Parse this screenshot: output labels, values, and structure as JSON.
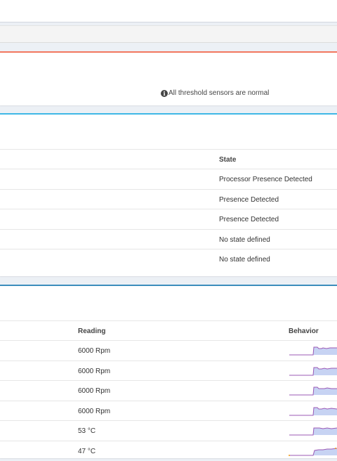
{
  "threshold_panel": {
    "status_text": "All threshold sensors are normal",
    "icon": "info-circle-icon"
  },
  "state_table": {
    "header": "State",
    "rows": [
      "Processor Presence Detected",
      "Presence Detected",
      "Presence Detected",
      "No state defined",
      "No state defined"
    ]
  },
  "reading_table": {
    "headers": {
      "reading": "Reading",
      "behavior": "Behavior"
    },
    "rows": [
      {
        "reading": "6000 Rpm"
      },
      {
        "reading": "6000 Rpm"
      },
      {
        "reading": "6000 Rpm"
      },
      {
        "reading": "6000 Rpm"
      },
      {
        "reading": "53 °C"
      },
      {
        "reading": "47 °C"
      }
    ]
  },
  "colors": {
    "accent_red": "#f2775f",
    "accent_blue_light": "#3fb8e6",
    "accent_blue": "#3c8dbc",
    "spark_line": "#9b59b6",
    "spark_fill": "#c7d3f3"
  }
}
